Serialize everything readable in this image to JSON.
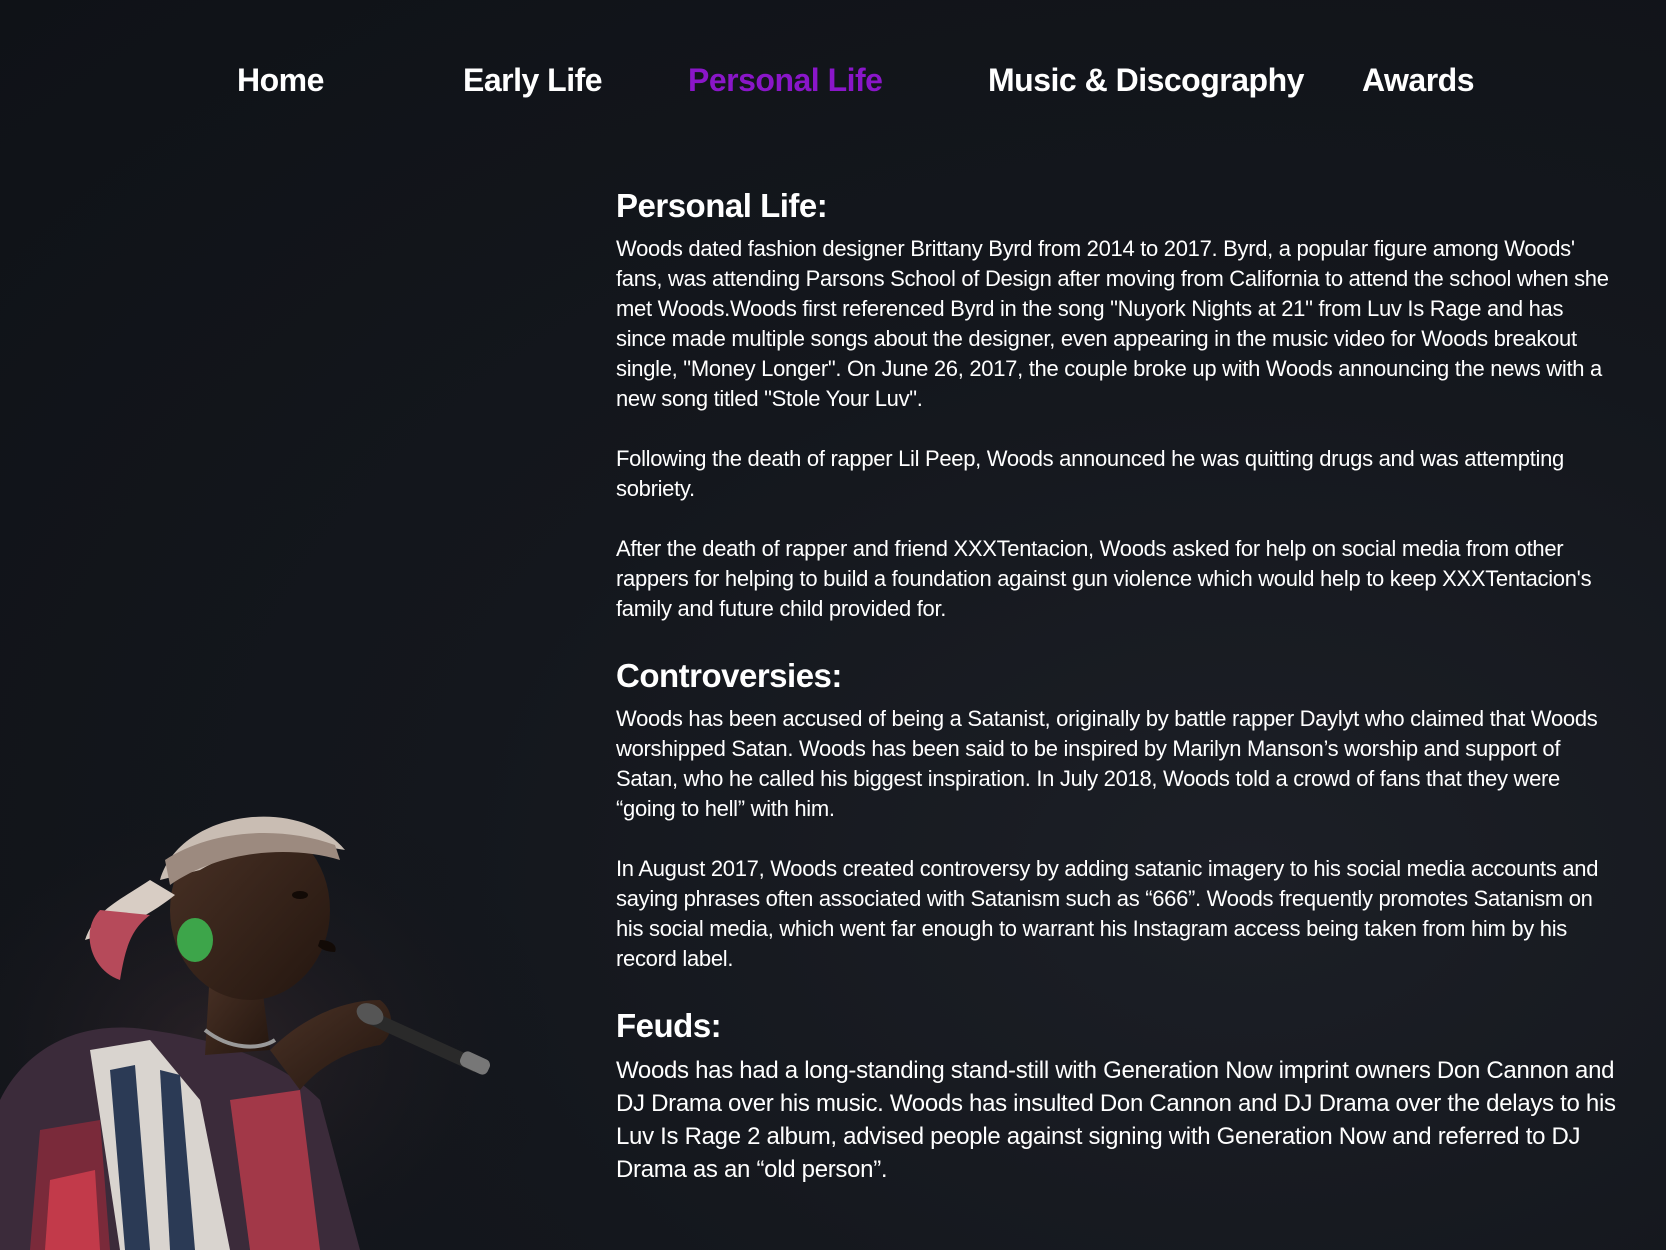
{
  "nav": {
    "items": [
      {
        "label": "Home",
        "active": false
      },
      {
        "label": "Early Life",
        "active": false
      },
      {
        "label": "Personal Life",
        "active": true
      },
      {
        "label": "Music & Discography",
        "active": false
      },
      {
        "label": "Awards",
        "active": false
      }
    ],
    "active_color": "#8a16c9"
  },
  "sections": [
    {
      "title": "Personal Life:",
      "paragraphs": [
        "Woods dated fashion designer Brittany Byrd from 2014 to 2017. Byrd, a popular figure among Woods' fans, was attending Parsons School of Design after moving from California to attend the school when she met Woods.Woods first referenced Byrd in the song \"Nuyork Nights at 21\" from Luv Is Rage and has since made multiple songs about the designer, even appearing in the music video for Woods breakout single, \"Money Longer\". On June 26, 2017, the couple broke up with Woods announcing the news with a new song titled \"Stole Your Luv\".",
        "Following the death of rapper Lil Peep, Woods announced he was quitting drugs and was attempting sobriety.",
        "After the death of rapper and friend XXXTentacion, Woods asked for help on social media from other rappers for helping to build a foundation against gun violence which would help to keep XXXTentacion's family and future child provided for."
      ]
    },
    {
      "title": "Controversies:",
      "paragraphs": [
        "Woods has been accused of being a Satanist, originally by battle rapper Daylyt who claimed that Woods worshipped Satan. Woods has been said to be inspired by Marilyn Manson’s worship and support of Satan, who he called his biggest inspiration. In July 2018, Woods told a crowd of fans that they were “going to hell” with him.",
        "In August 2017, Woods created controversy by adding satanic imagery to his social media accounts and saying phrases often associated with Satanism such as “666”. Woods frequently promotes Satanism on his social media, which went far enough to warrant his Instagram access being taken from him by his record label."
      ]
    },
    {
      "title": "Feuds:",
      "paragraphs": [
        "Woods has had a long-standing stand-still with Generation Now imprint owners Don Cannon and DJ Drama over his music. Woods has insulted Don Cannon and DJ Drama over the delays to his Luv Is Rage 2 album, advised people against signing with Generation Now and referred to DJ Drama as an “old person”."
      ]
    }
  ]
}
